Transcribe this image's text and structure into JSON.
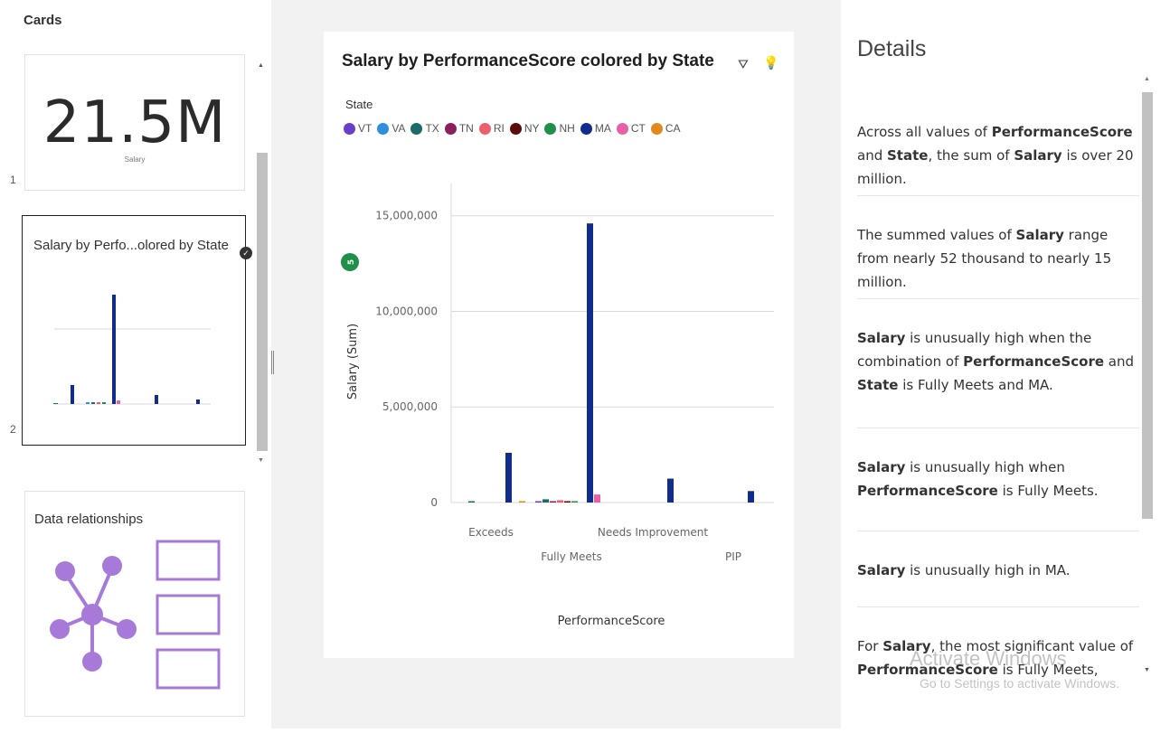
{
  "cards_panel": {
    "title": "Cards",
    "cards": [
      {
        "number": "1",
        "kpi_value": "21.5M",
        "kpi_label": "Salary"
      },
      {
        "number": "2",
        "title": "Salary by Perfo...olored by State",
        "selected": true
      },
      {
        "title": "Data relationships"
      }
    ]
  },
  "chart_card": {
    "title": "Salary by PerformanceScore colored by State",
    "filter_icon": "filter-icon",
    "insight_icon": "lightbulb-icon",
    "axis_badge": "5"
  },
  "chart_data": {
    "type": "bar",
    "title": "Salary by PerformanceScore colored by State",
    "xlabel": "PerformanceScore",
    "ylabel": "Salary (Sum)",
    "ylim": [
      0,
      16500000
    ],
    "yticks": [
      0,
      5000000,
      10000000,
      15000000
    ],
    "ytick_labels": [
      "0",
      "5,000,000",
      "10,000,000",
      "15,000,000"
    ],
    "grid": true,
    "legend_title": "State",
    "legend_position": "top-left",
    "categories": [
      "Exceeds",
      "Fully Meets",
      "Needs Improvement",
      "PIP"
    ],
    "series": [
      {
        "name": "VT",
        "color": "#6a3fc8",
        "values": [
          0,
          60000,
          0,
          0
        ]
      },
      {
        "name": "VA",
        "color": "#2f8fdd",
        "values": [
          0,
          0,
          0,
          0
        ]
      },
      {
        "name": "TX",
        "color": "#1b6b6b",
        "values": [
          60000,
          170000,
          0,
          0
        ]
      },
      {
        "name": "TN",
        "color": "#8b1f5c",
        "values": [
          0,
          60000,
          0,
          0
        ]
      },
      {
        "name": "RI",
        "color": "#ec5f6c",
        "values": [
          0,
          120000,
          0,
          0
        ]
      },
      {
        "name": "NY",
        "color": "#5a0b0b",
        "values": [
          0,
          60000,
          0,
          0
        ]
      },
      {
        "name": "NH",
        "color": "#1f8f4a",
        "values": [
          0,
          60000,
          0,
          0
        ]
      },
      {
        "name": "MA",
        "color": "#102d8c",
        "values": [
          2600000,
          14600000,
          1250000,
          600000
        ]
      },
      {
        "name": "CT",
        "color": "#e860a8",
        "values": [
          0,
          420000,
          0,
          0
        ]
      },
      {
        "name": "CA",
        "color": "#e08a1e",
        "values": [
          60000,
          0,
          0,
          0
        ]
      }
    ]
  },
  "details_panel": {
    "title": "Details",
    "insights": [
      [
        {
          "t": "Across all values of "
        },
        {
          "t": "PerformanceScore",
          "b": true
        },
        {
          "t": " and "
        },
        {
          "t": "State",
          "b": true
        },
        {
          "t": ", the sum of "
        },
        {
          "t": "Salary",
          "b": true
        },
        {
          "t": " is over 20 million."
        }
      ],
      [
        {
          "t": "The summed values of "
        },
        {
          "t": "Salary",
          "b": true
        },
        {
          "t": " range from nearly 52 thousand to nearly 15 million."
        }
      ],
      [
        {
          "t": "Salary",
          "b": true
        },
        {
          "t": " is unusually high when the combination of "
        },
        {
          "t": "PerformanceScore",
          "b": true
        },
        {
          "t": " and "
        },
        {
          "t": "State",
          "b": true
        },
        {
          "t": " is Fully Meets and MA."
        }
      ],
      [
        {
          "t": "Salary",
          "b": true
        },
        {
          "t": " is unusually high when "
        },
        {
          "t": "PerformanceScore",
          "b": true
        },
        {
          "t": " is Fully Meets."
        }
      ],
      [
        {
          "t": "Salary",
          "b": true
        },
        {
          "t": " is unusually high in MA."
        }
      ],
      [
        {
          "t": "For "
        },
        {
          "t": "Salary",
          "b": true
        },
        {
          "t": ", the most significant value of "
        },
        {
          "t": "PerformanceScore",
          "b": true
        },
        {
          "t": " is Fully Meets, whose"
        }
      ]
    ]
  },
  "watermark": {
    "line1": "Activate Windows",
    "line2": "Go to Settings to activate Windows."
  }
}
